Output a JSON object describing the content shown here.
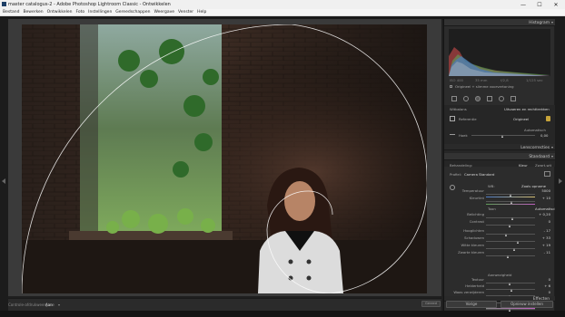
{
  "window": {
    "title": "master catalogus-2 - Adobe Photoshop Lightroom Classic - Ontwikkelen",
    "controls": {
      "minimize": "—",
      "maximize": "☐",
      "close": "✕"
    }
  },
  "menu": [
    "Bestand",
    "Bewerken",
    "Ontwikkelen",
    "Foto",
    "Instellingen",
    "Gereedschappen",
    "Weergave",
    "Venster",
    "Help"
  ],
  "toolbar": {
    "softproof_label": "Controle-afdrukweergave",
    "softproof_value": "Aan",
    "soft_button": "Gereed"
  },
  "right_panel": {
    "histogram": {
      "header": "Histogram",
      "readouts": [
        "ISO 400",
        "35 mm",
        "f/2,8",
        "1/125 sec"
      ],
      "original_label": "Origineel + slimme voorvertoning"
    },
    "whitebalance": {
      "header": "Witbalans",
      "section_label": "Uitvoeren en rechttrekken",
      "profile_label": "Referentie",
      "profile_value": "Origineel",
      "auto_label": "Automatisch",
      "slider_label": "Hoek",
      "slider_value": "0,00",
      "checkbox_label": "Beperken tot afsnijding",
      "btn_left": "Opnieuw instellen",
      "btn_right": "Sluiten"
    },
    "sections": {
      "lens": "Lenscorrecties",
      "basic": "Standaard"
    },
    "basic": {
      "treatment_label": "Behandeling:",
      "color": "Kleur",
      "bw": "Zwart-wit",
      "profile_label": "Profiel:",
      "profile_value": "Camera Standard",
      "wb_label": "WB:",
      "wb_value": "Zoals opname",
      "tone_label": "Toon",
      "tone_auto": "Automatisch",
      "presence_label": "Aanwezigheid",
      "sliders": [
        {
          "label": "Temperatuur",
          "value": "5000",
          "pos": 0.52
        },
        {
          "label": "Kleurtint",
          "value": "+ 10",
          "pos": 0.53
        },
        {
          "label": "Belichting",
          "value": "+ 0,20",
          "pos": 0.54
        },
        {
          "label": "Contrast",
          "value": "0",
          "pos": 0.5
        },
        {
          "label": "Hooglichten",
          "value": "- 17",
          "pos": 0.42
        },
        {
          "label": "Schaduwen",
          "value": "+ 33",
          "pos": 0.66
        },
        {
          "label": "Witte kleuren",
          "value": "+ 19",
          "pos": 0.59
        },
        {
          "label": "Zwarte kleuren",
          "value": "- 11",
          "pos": 0.45
        },
        {
          "label": "Textuur",
          "value": "0",
          "pos": 0.5
        },
        {
          "label": "Helderheid",
          "value": "+ 6",
          "pos": 0.53
        },
        {
          "label": "Waas verwijderen",
          "value": "0",
          "pos": 0.5
        },
        {
          "label": "Levendigheid",
          "value": "+ 13",
          "pos": 0.56
        },
        {
          "label": "Verzadiging",
          "value": "0",
          "pos": 0.5
        }
      ]
    },
    "effects_header": "Effecten",
    "btn_previous": "Vorige",
    "btn_reset": "Opnieuw instellen"
  },
  "colors": {
    "panel_bg": "#2c2c2c",
    "histogram_red": "#c04848",
    "histogram_green": "#5f9e58",
    "histogram_blue": "#4a7ac8"
  }
}
